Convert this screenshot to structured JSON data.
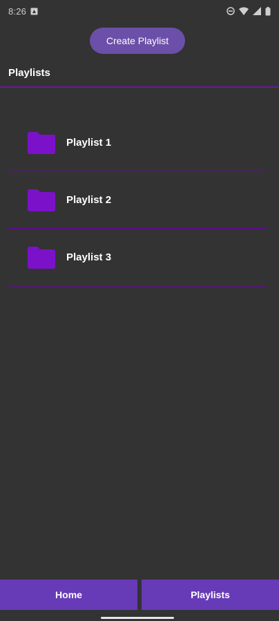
{
  "status_bar": {
    "time": "8:26",
    "icons": [
      "notification-icon",
      "dnd-icon",
      "wifi-icon",
      "signal-icon",
      "battery-icon"
    ]
  },
  "actions": {
    "create_label": "Create Playlist"
  },
  "section": {
    "title": "Playlists"
  },
  "playlists": [
    {
      "name": "Playlist 1"
    },
    {
      "name": "Playlist 2"
    },
    {
      "name": "Playlist 3"
    }
  ],
  "bottom_nav": {
    "home_label": "Home",
    "playlists_label": "Playlists"
  },
  "colors": {
    "background": "#333333",
    "accent": "#673ab7",
    "folder": "#7b12c9",
    "divider": "#5b1088"
  }
}
